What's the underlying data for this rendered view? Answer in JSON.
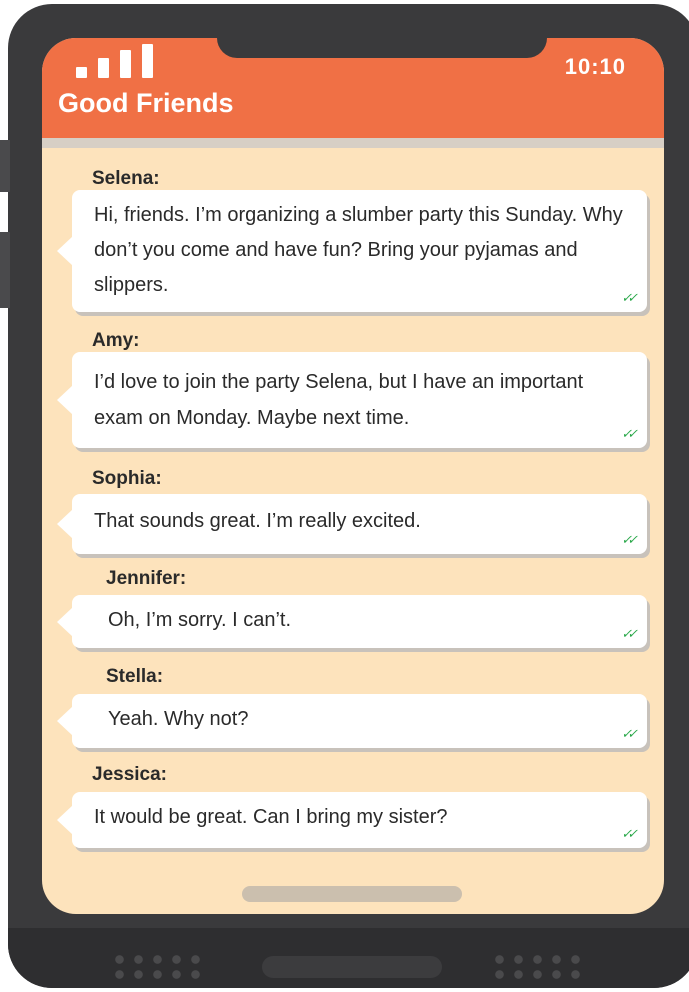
{
  "header": {
    "title": "Good Friends",
    "time": "10:10",
    "signal_icon": "signal-bars-icon",
    "color": "#f07045"
  },
  "messages": [
    {
      "sender": "Selena:",
      "text": "Hi, friends. I’m organizing a slumber party this Sunday. Why don’t you come and have fun? Bring your pyjamas and slippers.",
      "status": "✓✓"
    },
    {
      "sender": "Amy:",
      "text": "I’d love to join the party Selena, but I have an important exam on Monday. Maybe next time.",
      "status": "✓✓"
    },
    {
      "sender": "Sophia:",
      "text": "That sounds great. I’m really excited.",
      "status": "✓✓"
    },
    {
      "sender": "Jennifer:",
      "text": "Oh, I’m sorry. I can’t.",
      "status": "✓✓"
    },
    {
      "sender": "Stella:",
      "text": "Yeah. Why not?",
      "status": "✓✓"
    },
    {
      "sender": "Jessica:",
      "text": "It would be great. Can I bring my sister?",
      "status": "✓✓"
    }
  ]
}
